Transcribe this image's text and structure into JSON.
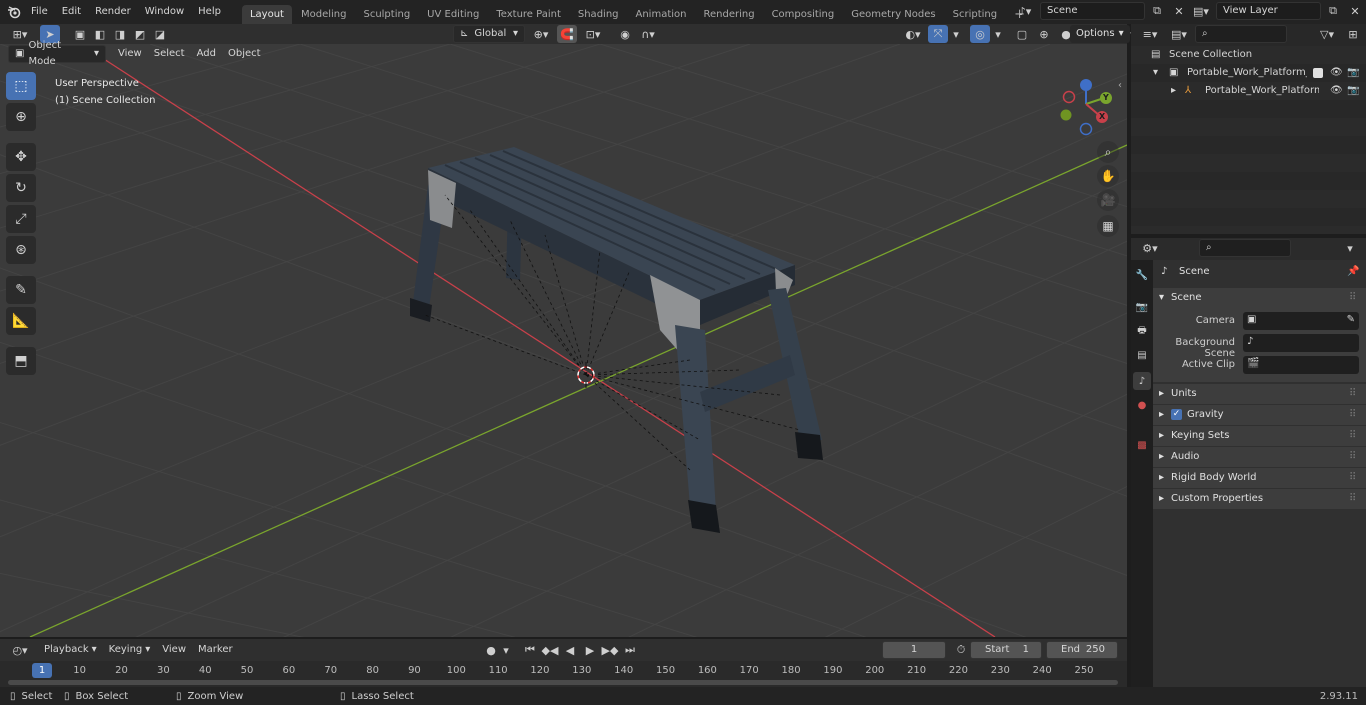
{
  "top_menu": [
    "File",
    "Edit",
    "Render",
    "Window",
    "Help"
  ],
  "workspaces": [
    "Layout",
    "Modeling",
    "Sculpting",
    "UV Editing",
    "Texture Paint",
    "Shading",
    "Animation",
    "Rendering",
    "Compositing",
    "Geometry Nodes",
    "Scripting"
  ],
  "active_workspace": "Layout",
  "scene_field": "Scene",
  "view_layer_field": "View Layer",
  "viewport_header": {
    "mode": "Object Mode",
    "menus": [
      "View",
      "Select",
      "Add",
      "Object"
    ],
    "transform_orientation": "Global",
    "options_label": "Options"
  },
  "viewport_info": {
    "line1": "User Perspective",
    "line2": "(1) Scene Collection"
  },
  "gizmo_labels": {
    "y": "Y",
    "x": "X"
  },
  "timeline": {
    "menus": [
      "Playback",
      "Keying",
      "View",
      "Marker"
    ],
    "current_frame": "1",
    "start_label": "Start",
    "start_value": "1",
    "end_label": "End",
    "end_value": "250",
    "ticks": [
      "1",
      "10",
      "20",
      "30",
      "40",
      "50",
      "60",
      "70",
      "80",
      "90",
      "100",
      "110",
      "120",
      "130",
      "140",
      "150",
      "160",
      "170",
      "180",
      "190",
      "200",
      "210",
      "220",
      "230",
      "240",
      "250"
    ]
  },
  "outliner": {
    "root": "Scene Collection",
    "collection": "Portable_Work_Platform_Star",
    "object": "Portable_Work_Platform_"
  },
  "properties": {
    "context": "Scene",
    "panel_title": "Scene",
    "camera_label": "Camera",
    "background_label": "Background Scene",
    "active_clip_label": "Active Clip",
    "subpanels": [
      "Units",
      "Gravity",
      "Keying Sets",
      "Audio",
      "Rigid Body World",
      "Custom Properties"
    ]
  },
  "statusbar": {
    "select": "Select",
    "box_select": "Box Select",
    "zoom_view": "Zoom View",
    "lasso_select": "Lasso Select",
    "version": "2.93.11"
  },
  "colors": {
    "accent": "#4772b3",
    "x_axis": "#c8404a",
    "y_axis": "#7aa52d",
    "grid_bg": "#3b3b3b"
  }
}
